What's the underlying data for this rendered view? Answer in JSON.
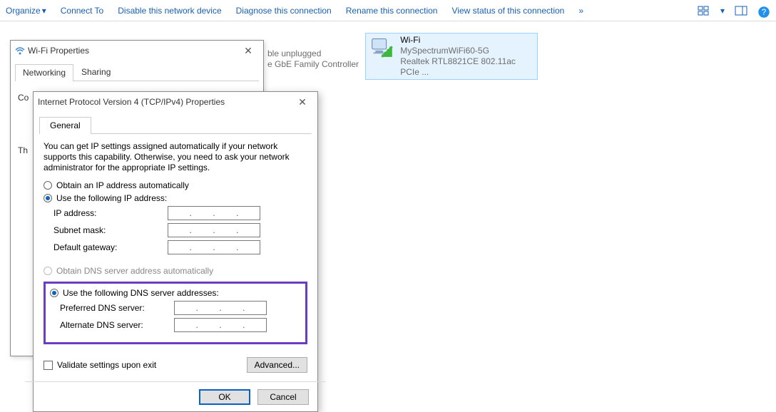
{
  "toolbar": {
    "organize": "Organize",
    "connect_to": "Connect To",
    "disable": "Disable this network device",
    "diagnose": "Diagnose this connection",
    "rename": "Rename this connection",
    "view_status": "View status of this connection",
    "more": "»"
  },
  "background_fragments": {
    "frag1": "ble unplugged",
    "frag2": "e GbE Family Controller"
  },
  "connection_wifi": {
    "name": "Wi-Fi",
    "ssid": "MySpectrumWiFi60-5G",
    "adapter": "Realtek RTL8821CE 802.11ac PCIe ..."
  },
  "dlg_wifi": {
    "title": "Wi-Fi Properties",
    "tabs": {
      "networking": "Networking",
      "sharing": "Sharing"
    },
    "connect_label": "Co",
    "this_label": "Th"
  },
  "dlg_ipv4": {
    "title": "Internet Protocol Version 4 (TCP/IPv4) Properties",
    "tab_general": "General",
    "desc": "You can get IP settings assigned automatically if your network supports this capability. Otherwise, you need to ask your network administrator for the appropriate IP settings.",
    "opt_obtain_ip": "Obtain an IP address automatically",
    "opt_use_ip": "Use the following IP address:",
    "ip_address": "IP address:",
    "subnet": "Subnet mask:",
    "gateway": "Default gateway:",
    "opt_obtain_dns": "Obtain DNS server address automatically",
    "opt_use_dns": "Use the following DNS server addresses:",
    "pref_dns": "Preferred DNS server:",
    "alt_dns": "Alternate DNS server:",
    "validate": "Validate settings upon exit",
    "advanced": "Advanced...",
    "ok": "OK",
    "cancel": "Cancel",
    "dot_sep": "."
  }
}
